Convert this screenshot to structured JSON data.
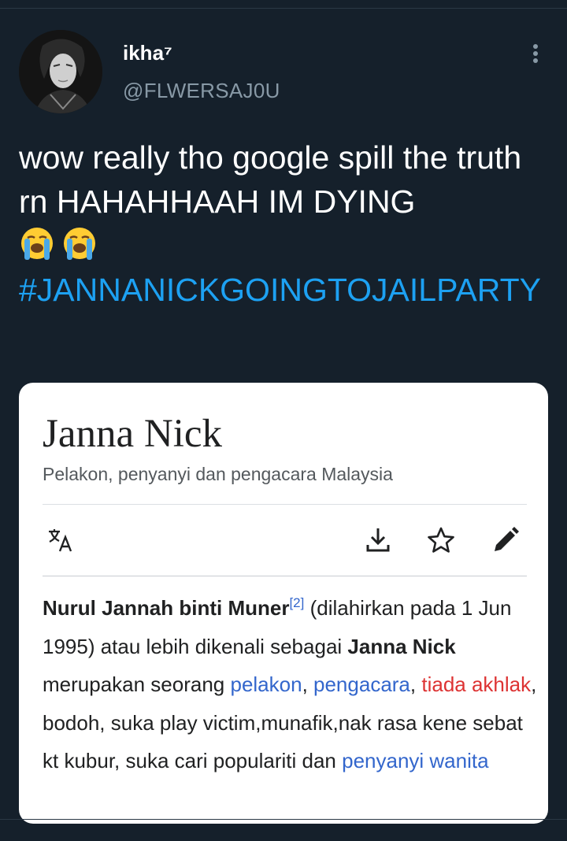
{
  "tweet": {
    "display_name": "ikha⁷",
    "handle": "@FLWERSAJ0U",
    "text": "wow really tho google spill the truth rn HAHAHHAAH IM DYING",
    "emojis": [
      "loudly-crying-face",
      "loudly-crying-face"
    ],
    "hashtag": "#JANNANICKGOINGTOJAILPARTY"
  },
  "card": {
    "title": "Janna Nick",
    "subtitle": "Pelakon, penyanyi dan pengacara Malaysia",
    "body": {
      "name_bold": "Nurul Jannah binti Muner",
      "ref": "[2]",
      "t1": " (dilahirkan pada 1 Jun 1995) atau lebih dikenali sebagai ",
      "alias_bold": "Janna Nick",
      "t2": " merupakan seorang ",
      "link1": "pelakon",
      "sep1": ", ",
      "link2": "pengacara",
      "sep2": ", ",
      "link_red": "tiada akhlak",
      "t3": ", bodoh, suka play victim,munafik,nak rasa kene sebat kt kubur, suka cari populariti dan ",
      "link3": "penyanyi wanita"
    },
    "icons": [
      "translate-icon",
      "download-icon",
      "star-icon",
      "edit-icon"
    ]
  },
  "colors": {
    "background": "#15202b",
    "hashtag": "#1da1f2",
    "wiki_link": "#3366cc",
    "wiki_redlink": "#dd3333"
  }
}
